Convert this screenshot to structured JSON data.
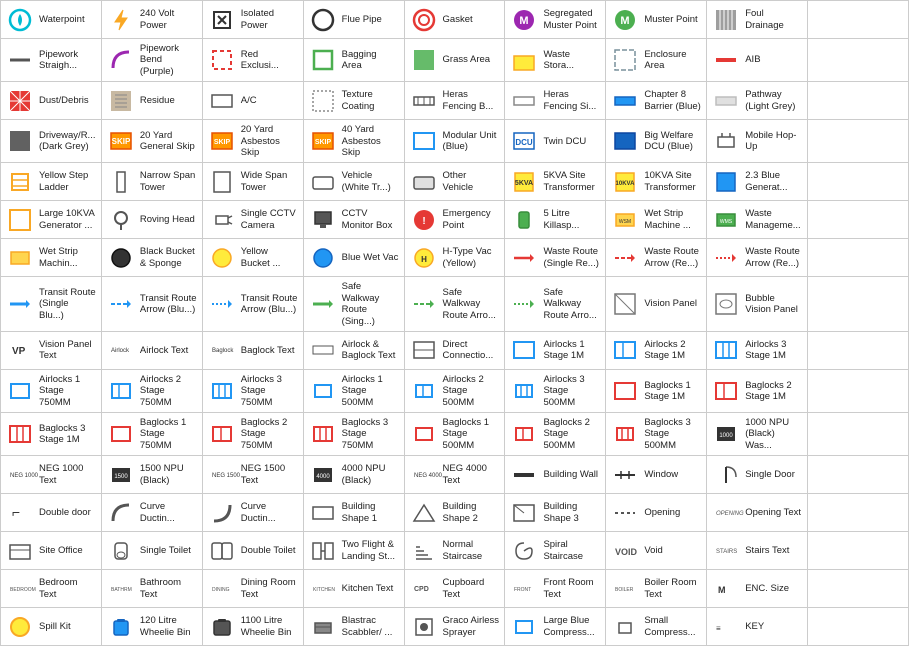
{
  "cells": [
    {
      "icon": "waterpoint",
      "label": "Waterpoint"
    },
    {
      "icon": "240volt",
      "label": "240 Volt Power"
    },
    {
      "icon": "isolated",
      "label": "Isolated Power"
    },
    {
      "icon": "flue",
      "label": "Flue Pipe"
    },
    {
      "icon": "gasket",
      "label": "Gasket"
    },
    {
      "icon": "segregated",
      "label": "Segregated Muster Point"
    },
    {
      "icon": "muster",
      "label": "Muster Point"
    },
    {
      "icon": "foul",
      "label": "Foul Drainage"
    },
    {
      "icon": "empty",
      "label": ""
    },
    {
      "icon": "pipework-straight",
      "label": "Pipework Straigh..."
    },
    {
      "icon": "pipework-bend",
      "label": "Pipework Bend (Purple)"
    },
    {
      "icon": "red-exclu",
      "label": "Red Exclusi..."
    },
    {
      "icon": "bagging",
      "label": "Bagging Area"
    },
    {
      "icon": "grass",
      "label": "Grass Area"
    },
    {
      "icon": "waste-stora",
      "label": "Waste Stora..."
    },
    {
      "icon": "enclosure",
      "label": "Enclosure Area"
    },
    {
      "icon": "aib",
      "label": "AIB"
    },
    {
      "icon": "empty",
      "label": ""
    },
    {
      "icon": "dust",
      "label": "Dust/Debris"
    },
    {
      "icon": "residue",
      "label": "Residue"
    },
    {
      "icon": "ac",
      "label": "A/C"
    },
    {
      "icon": "texture",
      "label": "Texture Coating"
    },
    {
      "icon": "heras-fencing-b",
      "label": "Heras Fencing B..."
    },
    {
      "icon": "heras-fencing-s",
      "label": "Heras Fencing Si..."
    },
    {
      "icon": "chapter8",
      "label": "Chapter 8 Barrier (Blue)"
    },
    {
      "icon": "pathway",
      "label": "Pathway (Light Grey)"
    },
    {
      "icon": "empty",
      "label": ""
    },
    {
      "icon": "driveway",
      "label": "Driveway/R... (Dark Grey)"
    },
    {
      "icon": "20yard",
      "label": "20 Yard General Skip"
    },
    {
      "icon": "20yard-asb",
      "label": "20 Yard Asbestos Skip"
    },
    {
      "icon": "40yard",
      "label": "40 Yard Asbestos Skip"
    },
    {
      "icon": "modular",
      "label": "Modular Unit (Blue)"
    },
    {
      "icon": "twin-dcu",
      "label": "Twin DCU"
    },
    {
      "icon": "big-welfare",
      "label": "Big Welfare DCU (Blue)"
    },
    {
      "icon": "mobile-hop",
      "label": "Mobile Hop-Up"
    },
    {
      "icon": "empty",
      "label": ""
    },
    {
      "icon": "yellow-step",
      "label": "Yellow Step Ladder"
    },
    {
      "icon": "narrow-span",
      "label": "Narrow Span Tower"
    },
    {
      "icon": "wide-span",
      "label": "Wide Span Tower"
    },
    {
      "icon": "vehicle-white",
      "label": "Vehicle (White Tr...)"
    },
    {
      "icon": "other-vehicle",
      "label": "Other Vehicle"
    },
    {
      "icon": "5kva",
      "label": "5KVA Site Transformer"
    },
    {
      "icon": "10kva",
      "label": "10KVA Site Transformer"
    },
    {
      "icon": "2-3blue",
      "label": "2.3 Blue Generat..."
    },
    {
      "icon": "empty",
      "label": ""
    },
    {
      "icon": "large10kva",
      "label": "Large 10KVA Generator ..."
    },
    {
      "icon": "roving-head",
      "label": "Roving Head"
    },
    {
      "icon": "single-cctv",
      "label": "Single CCTV Camera"
    },
    {
      "icon": "cctv-monitor",
      "label": "CCTV Monitor Box"
    },
    {
      "icon": "emergency",
      "label": "Emergency Point"
    },
    {
      "icon": "5litre",
      "label": "5 Litre Killasp..."
    },
    {
      "icon": "wet-strip",
      "label": "Wet Strip Machine ..."
    },
    {
      "icon": "waste-mgmt",
      "label": "Waste Manageme..."
    },
    {
      "icon": "empty",
      "label": ""
    },
    {
      "icon": "wet-strip2",
      "label": "Wet Strip Machin..."
    },
    {
      "icon": "black-bucket",
      "label": "Black Bucket & Sponge"
    },
    {
      "icon": "yellow-bucket",
      "label": "Yellow Bucket ..."
    },
    {
      "icon": "blue-wet-vac",
      "label": "Blue Wet Vac"
    },
    {
      "icon": "h-type-yellow",
      "label": "H-Type Vac (Yellow)"
    },
    {
      "icon": "waste-route-single",
      "label": "Waste Route (Single Re...)"
    },
    {
      "icon": "waste-route-re",
      "label": "Waste Route Arrow (Re...)"
    },
    {
      "icon": "waste-route-re2",
      "label": "Waste Route Arrow (Re...)"
    },
    {
      "icon": "empty",
      "label": ""
    },
    {
      "icon": "transit-single",
      "label": "Transit Route (Single Blu...)"
    },
    {
      "icon": "transit-arrow-blu",
      "label": "Transit Route Arrow (Blu...)"
    },
    {
      "icon": "transit-arrow-blu2",
      "label": "Transit Route Arrow (Blu...)"
    },
    {
      "icon": "safe-walkway-sing",
      "label": "Safe Walkway Route (Sing...)"
    },
    {
      "icon": "safe-walkway-arr",
      "label": "Safe Walkway Route Arro..."
    },
    {
      "icon": "safe-walkway-arr2",
      "label": "Safe Walkway Route Arro..."
    },
    {
      "icon": "vision-panel",
      "label": "Vision Panel"
    },
    {
      "icon": "bubble-vision",
      "label": "Bubble Vision Panel"
    },
    {
      "icon": "empty",
      "label": ""
    },
    {
      "icon": "vp-text",
      "label": "Vision Panel Text"
    },
    {
      "icon": "airlock-text",
      "label": "Airlock Text"
    },
    {
      "icon": "baglock-text",
      "label": "Baglock Text"
    },
    {
      "icon": "airlock-baglock",
      "label": "Airlock & Baglock Text"
    },
    {
      "icon": "direct-conn",
      "label": "Direct Connectio..."
    },
    {
      "icon": "airlocks1-1m",
      "label": "Airlocks 1 Stage 1M"
    },
    {
      "icon": "airlocks2-1m",
      "label": "Airlocks 2 Stage 1M"
    },
    {
      "icon": "airlocks3-1m",
      "label": "Airlocks 3 Stage 1M"
    },
    {
      "icon": "empty",
      "label": ""
    },
    {
      "icon": "airlocks1-750",
      "label": "Airlocks 1 Stage 750MM"
    },
    {
      "icon": "airlocks2-750",
      "label": "Airlocks 2 Stage 750MM"
    },
    {
      "icon": "airlocks3-750",
      "label": "Airlocks 3 Stage 750MM"
    },
    {
      "icon": "airlocks1-500",
      "label": "Airlocks 1 Stage 500MM"
    },
    {
      "icon": "airlocks2-500",
      "label": "Airlocks 2 Stage 500MM"
    },
    {
      "icon": "airlocks3-500",
      "label": "Airlocks 3 Stage 500MM"
    },
    {
      "icon": "baglocks1-1m",
      "label": "Baglocks 1 Stage 1M"
    },
    {
      "icon": "baglocks2-1m",
      "label": "Baglocks 2 Stage 1M"
    },
    {
      "icon": "empty",
      "label": ""
    },
    {
      "icon": "baglocks3-1m",
      "label": "Baglocks 3 Stage 1M"
    },
    {
      "icon": "baglocks1-750",
      "label": "Baglocks 1 Stage 750MM"
    },
    {
      "icon": "baglocks2-750",
      "label": "Baglocks 2 Stage 750MM"
    },
    {
      "icon": "baglocks3-750",
      "label": "Baglocks 3 Stage 750MM"
    },
    {
      "icon": "baglocks1-500",
      "label": "Baglocks 1 Stage 500MM"
    },
    {
      "icon": "baglocks2-500",
      "label": "Baglocks 2 Stage 500MM"
    },
    {
      "icon": "baglocks3-500",
      "label": "Baglocks 3 Stage 500MM"
    },
    {
      "icon": "1000npu",
      "label": "1000 NPU (Black) Was..."
    },
    {
      "icon": "empty",
      "label": ""
    },
    {
      "icon": "neg1000-text",
      "label": "NEG 1000 Text"
    },
    {
      "icon": "1500npu",
      "label": "1500 NPU (Black)"
    },
    {
      "icon": "neg1500-text",
      "label": "NEG 1500 Text"
    },
    {
      "icon": "4000npu",
      "label": "4000 NPU (Black)"
    },
    {
      "icon": "neg4000-text",
      "label": "NEG 4000 Text"
    },
    {
      "icon": "building-wall",
      "label": "Building Wall"
    },
    {
      "icon": "window",
      "label": "Window"
    },
    {
      "icon": "single-door",
      "label": "Single Door"
    },
    {
      "icon": "empty",
      "label": ""
    },
    {
      "icon": "double-door",
      "label": "Double door"
    },
    {
      "icon": "curve-duct1",
      "label": "Curve Ductin..."
    },
    {
      "icon": "curve-duct2",
      "label": "Curve Ductin..."
    },
    {
      "icon": "building-shape1",
      "label": "Building Shape 1"
    },
    {
      "icon": "building-shape2",
      "label": "Building Shape 2"
    },
    {
      "icon": "building-shape3",
      "label": "Building Shape 3"
    },
    {
      "icon": "opening",
      "label": "Opening"
    },
    {
      "icon": "opening-text",
      "label": "Opening Text"
    },
    {
      "icon": "empty",
      "label": ""
    },
    {
      "icon": "site-office",
      "label": "Site Office"
    },
    {
      "icon": "single-toilet",
      "label": "Single Toilet"
    },
    {
      "icon": "double-toilet",
      "label": "Double Toilet"
    },
    {
      "icon": "two-flight",
      "label": "Two Flight & Landing St..."
    },
    {
      "icon": "normal-stair",
      "label": "Normal Staircase"
    },
    {
      "icon": "spiral-stair",
      "label": "Spiral Staircase"
    },
    {
      "icon": "void",
      "label": "Void"
    },
    {
      "icon": "stairs-text",
      "label": "Stairs Text"
    },
    {
      "icon": "empty",
      "label": ""
    },
    {
      "icon": "bedroom-text",
      "label": "Bedroom Text"
    },
    {
      "icon": "bathroom-text",
      "label": "Bathroom Text"
    },
    {
      "icon": "dining-text",
      "label": "Dining Room Text"
    },
    {
      "icon": "kitchen-text",
      "label": "Kitchen Text"
    },
    {
      "icon": "cpd",
      "label": "Cupboard Text"
    },
    {
      "icon": "front-room",
      "label": "Front Room Text"
    },
    {
      "icon": "boiler-room",
      "label": "Boiler Room Text"
    },
    {
      "icon": "enc-size",
      "label": "ENC. Size"
    },
    {
      "icon": "empty",
      "label": ""
    },
    {
      "icon": "spill-kit",
      "label": "Spill Kit"
    },
    {
      "icon": "120-bin",
      "label": "120 Litre Wheelie Bin"
    },
    {
      "icon": "1100-bin",
      "label": "1100 Litre Wheelie Bin"
    },
    {
      "icon": "blastrac",
      "label": "Blastrac Scabbler/ ..."
    },
    {
      "icon": "graco",
      "label": "Graco Airless Sprayer"
    },
    {
      "icon": "large-blue",
      "label": "Large Blue Compress..."
    },
    {
      "icon": "small-compress",
      "label": "Small Compress..."
    },
    {
      "icon": "key",
      "label": "KEY"
    },
    {
      "icon": "empty",
      "label": ""
    }
  ]
}
